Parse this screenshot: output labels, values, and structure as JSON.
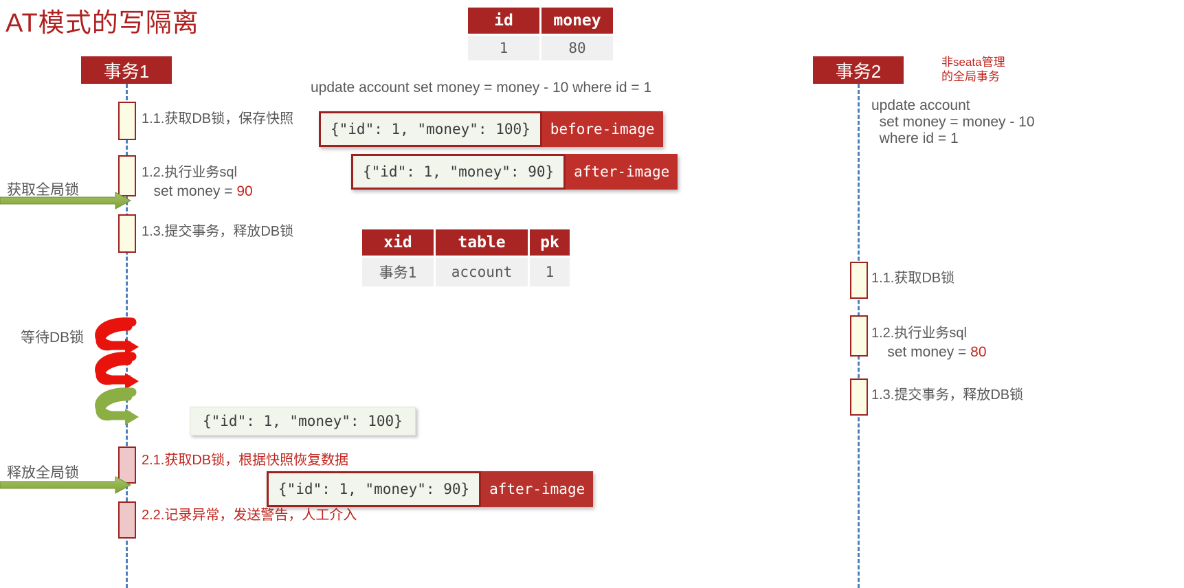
{
  "title": "AT模式的写隔离",
  "colors": {
    "brand_red": "#a92524",
    "text_gray": "#595959",
    "accent_red": "#c0261f",
    "lifeline_blue": "#4f81bd",
    "green_arrow": "#8bae45",
    "spiral_red": "#e8130c",
    "activation_fill": "#fcfbe3",
    "rollback_fill": "#eec8c8"
  },
  "account_table": {
    "headers": [
      "id",
      "money"
    ],
    "rows": [
      [
        "1",
        "80"
      ]
    ]
  },
  "lock_table": {
    "headers": [
      "xid",
      "table",
      "pk"
    ],
    "rows": [
      [
        "事务1",
        "account",
        "1"
      ]
    ]
  },
  "main_sql": "update account set money = money - 10 where id = 1",
  "lane1": {
    "header": "事务1",
    "steps": [
      {
        "text": "1.1.获取DB锁，保存快照"
      },
      {
        "text": "1.2.执行业务sql"
      },
      {
        "text": "1.3.提交事务，释放DB锁"
      },
      {
        "text": "2.1.获取DB锁，根据快照恢复数据"
      },
      {
        "text": "2.2.记录异常，发送警告，人工介入"
      }
    ],
    "sql_set_prefix": "   set money = ",
    "sql_set_value": "90"
  },
  "lane2": {
    "header": "事务2",
    "note": "非seata管理\n的全局事务",
    "sql_line1": "update account",
    "sql_line2": "  set money = money - 10",
    "sql_line3": "  where id = 1",
    "steps": [
      {
        "text": "1.1.获取DB锁"
      },
      {
        "text": "1.2.执行业务sql"
      },
      {
        "text": "1.3.提交事务，释放DB锁"
      }
    ],
    "sql_set_prefix": "    set money = ",
    "sql_set_value": "80"
  },
  "images": {
    "before_json": "{\"id\": 1, \"money\": 100}",
    "before_tag": "before-image",
    "after_json": "{\"id\": 1, \"money\": 90}",
    "after_tag": "after-image",
    "rollback_snapshot": "{\"id\": 1, \"money\": 100}",
    "rollback_json": "{\"id\": 1, \"money\": 90}",
    "rollback_tag": "after-image"
  },
  "side_labels": {
    "acquire_global_lock": "获取全局锁",
    "wait_db_lock": "等待DB锁",
    "release_global_lock": "释放全局锁"
  }
}
